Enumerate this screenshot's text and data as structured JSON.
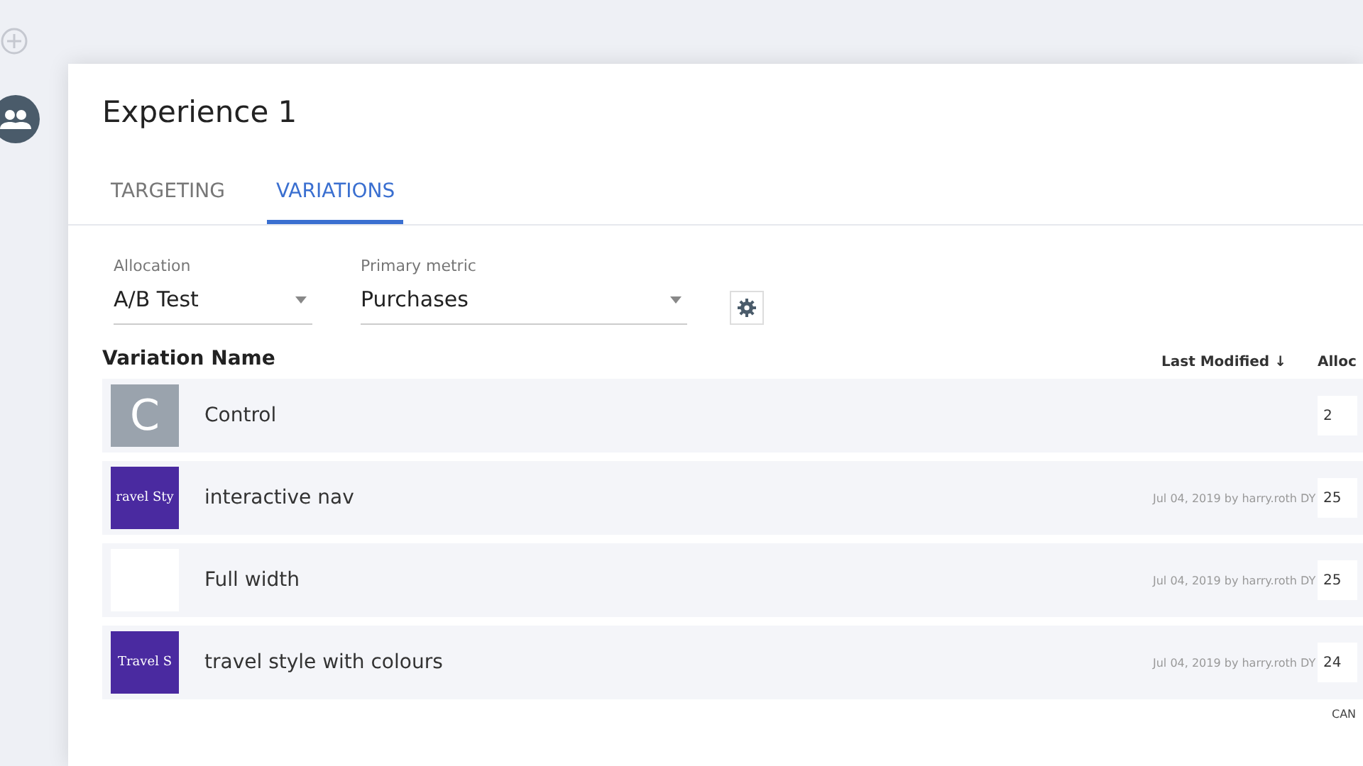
{
  "experience": {
    "title": "Experience 1"
  },
  "tabs": [
    {
      "label": "TARGETING",
      "selected": false
    },
    {
      "label": "VARIATIONS",
      "selected": true
    }
  ],
  "allocation": {
    "label": "Allocation",
    "value": "A/B Test"
  },
  "primary_metric": {
    "label": "Primary metric",
    "value": "Purchases"
  },
  "table": {
    "columns": [
      "Variation Name",
      "Last Modified ↓",
      "Alloc"
    ],
    "rows": [
      {
        "kind": "letter",
        "thumb_text": "C",
        "name": "Control",
        "modified": "",
        "allocation": "2"
      },
      {
        "kind": "text",
        "thumb_text": "ravel Sty",
        "name": "interactive nav",
        "modified": "Jul 04, 2019 by harry.roth DY",
        "allocation": "25"
      },
      {
        "kind": "blank",
        "name": "Full width",
        "modified": "Jul 04, 2019 by harry.roth DY",
        "allocation": "25"
      },
      {
        "kind": "text",
        "thumb_text": "Travel S",
        "name": "travel style with colours",
        "modified": "Jul 04, 2019 by harry.roth DY",
        "allocation": "24"
      }
    ]
  },
  "footer_button": "CAN"
}
